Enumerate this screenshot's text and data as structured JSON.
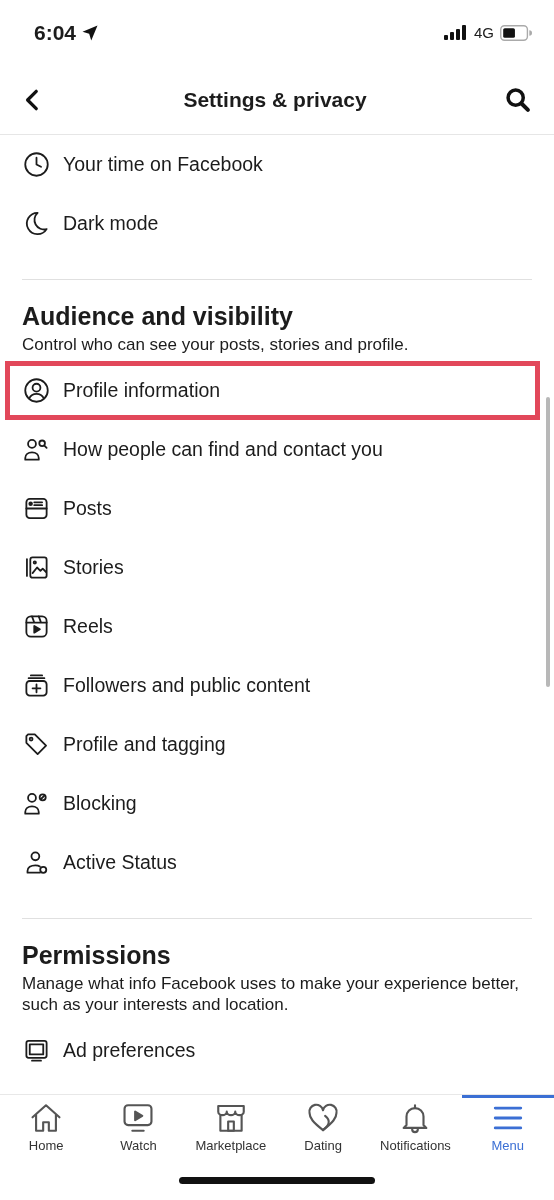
{
  "status_bar": {
    "time": "6:04",
    "network": "4G"
  },
  "header": {
    "title": "Settings & privacy"
  },
  "sections": [
    {
      "items": [
        {
          "label": "Your time on Facebook",
          "kind": "clock",
          "highlighted": false
        },
        {
          "label": "Dark mode",
          "kind": "moon",
          "highlighted": false
        }
      ]
    },
    {
      "title": "Audience and visibility",
      "description": "Control who can see your posts, stories and profile.",
      "items": [
        {
          "label": "Profile information",
          "kind": "person-circle",
          "highlighted": true
        },
        {
          "label": "How people can find and contact you",
          "kind": "person-search",
          "highlighted": false
        },
        {
          "label": "Posts",
          "kind": "posts",
          "highlighted": false
        },
        {
          "label": "Stories",
          "kind": "stories",
          "highlighted": false
        },
        {
          "label": "Reels",
          "kind": "reels",
          "highlighted": false
        },
        {
          "label": "Followers and public content",
          "kind": "followers",
          "highlighted": false
        },
        {
          "label": "Profile and tagging",
          "kind": "tag",
          "highlighted": false
        },
        {
          "label": "Blocking",
          "kind": "blocking",
          "highlighted": false
        },
        {
          "label": "Active Status",
          "kind": "active-status",
          "highlighted": false
        }
      ]
    },
    {
      "title": "Permissions",
      "description": "Manage what info Facebook uses to make your experience better, such as your interests and location.",
      "items": [
        {
          "label": "Ad preferences",
          "kind": "ad",
          "highlighted": false
        }
      ]
    }
  ],
  "tab_bar": [
    {
      "label": "Home",
      "kind": "home",
      "selected": false
    },
    {
      "label": "Watch",
      "kind": "watch",
      "selected": false
    },
    {
      "label": "Marketplace",
      "kind": "marketplace",
      "selected": false
    },
    {
      "label": "Dating",
      "kind": "dating",
      "selected": false
    },
    {
      "label": "Notifications",
      "kind": "notifications",
      "selected": false
    },
    {
      "label": "Menu",
      "kind": "menu",
      "selected": true
    }
  ]
}
